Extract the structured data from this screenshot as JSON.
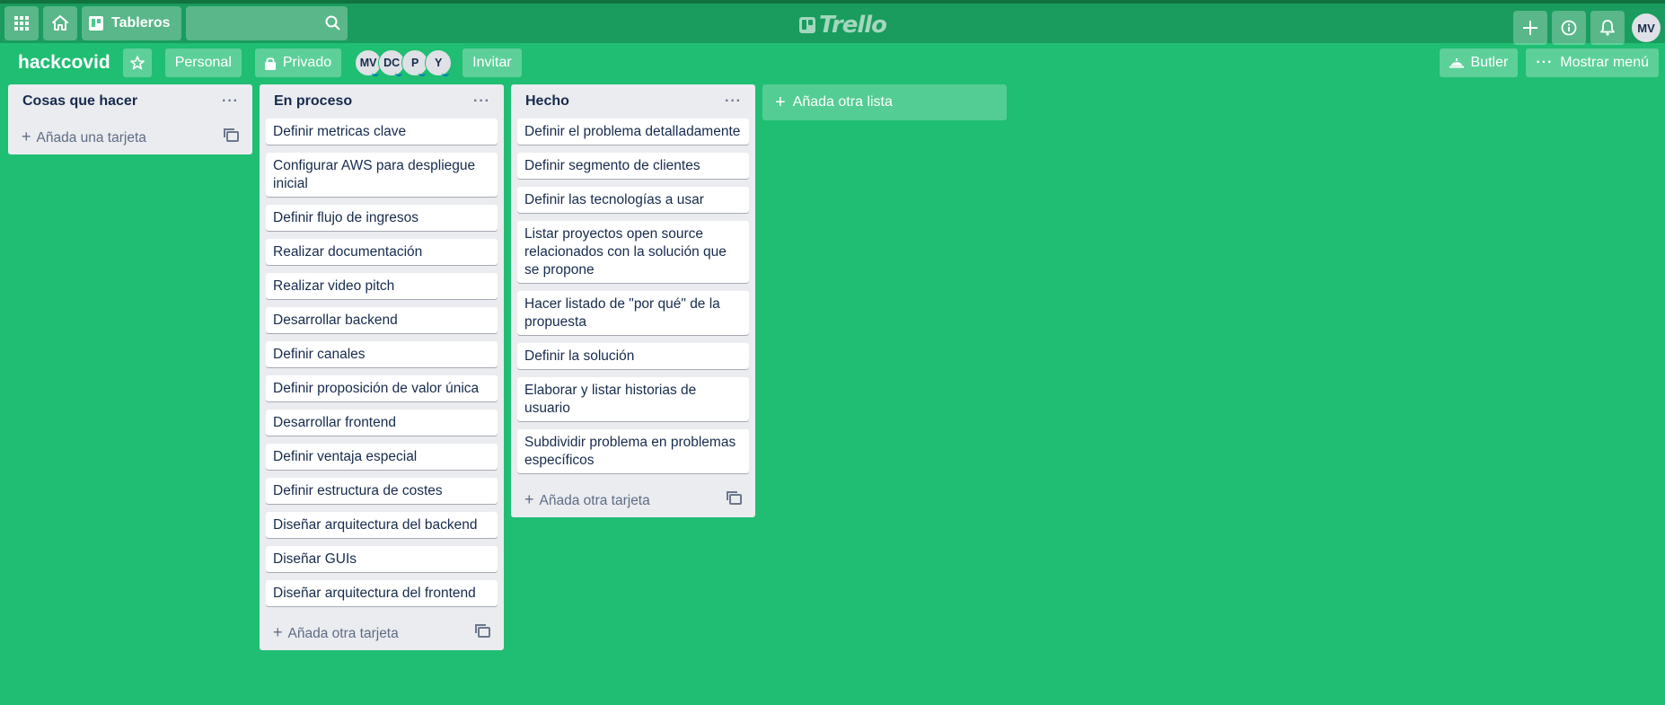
{
  "topbar": {
    "boards_label": "Tableros",
    "search_value": "",
    "logo_text": "Trello",
    "user_initials": "MV"
  },
  "board": {
    "name": "hackcovid",
    "visibility_team": "Personal",
    "visibility_privacy": "Privado",
    "members": [
      "MV",
      "DC",
      "P",
      "Y"
    ],
    "invite_label": "Invitar",
    "butler_label": "Butler",
    "menu_label": "Mostrar menú"
  },
  "lists": [
    {
      "title": "Cosas que hacer",
      "cards": [],
      "add_label": "Añada una tarjeta"
    },
    {
      "title": "En proceso",
      "cards": [
        "Definir metricas clave",
        "Configurar AWS para despliegue inicial",
        "Definir flujo de ingresos",
        "Realizar documentación",
        "Realizar video pitch",
        "Desarrollar backend",
        "Definir canales",
        "Definir proposición de valor única",
        "Desarrollar frontend",
        "Definir ventaja especial",
        "Definir estructura de costes",
        "Diseñar arquitectura del backend",
        "Diseñar GUIs",
        "Diseñar arquitectura del frontend"
      ],
      "add_label": "Añada otra tarjeta"
    },
    {
      "title": "Hecho",
      "cards": [
        "Definir el problema detalladamente",
        "Definir segmento de clientes",
        "Definir las tecnologías a usar",
        "Listar proyectos open source relacionados con la solución que se propone",
        "Hacer listado de \"por qué\" de la propuesta",
        "Definir la solución",
        "Elaborar y listar historias de usuario",
        "Subdividir problema en problemas específicos"
      ],
      "add_label": "Añada otra tarjeta"
    }
  ],
  "add_list_label": "Añada otra lista",
  "colors": {
    "board_background": "#1fbe73",
    "topbar": "#199c5e",
    "list_background": "#ebecf0"
  }
}
